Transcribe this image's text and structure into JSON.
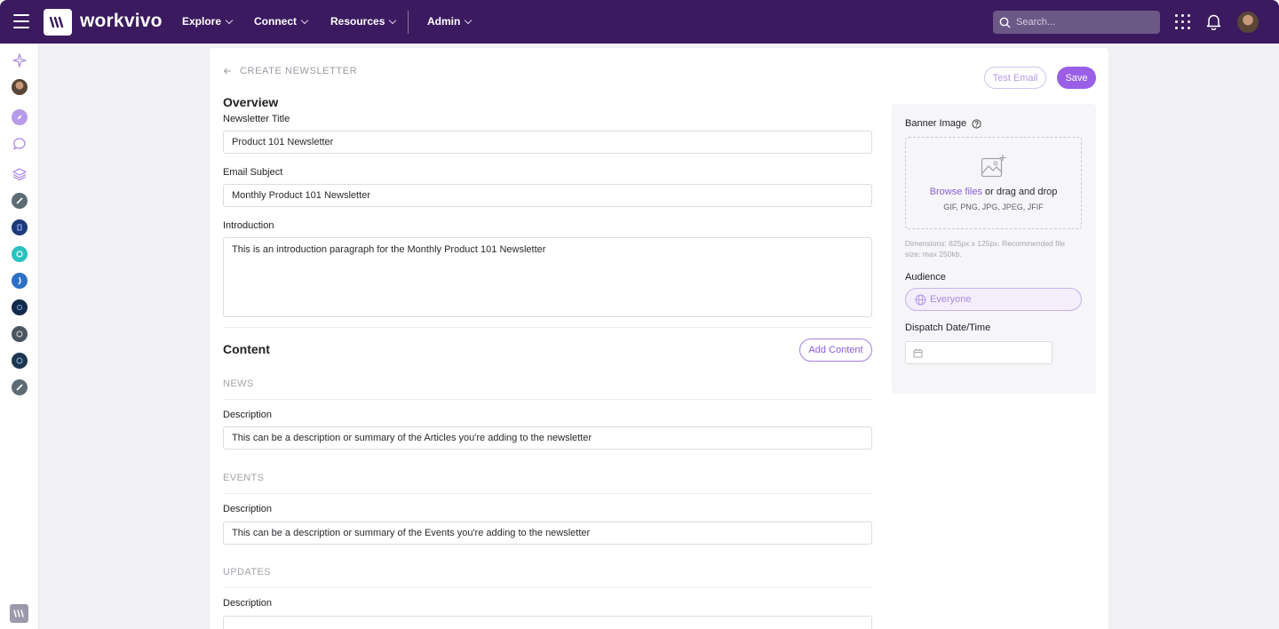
{
  "app": {
    "brand": "workvivo",
    "accent": "#9a5fe6",
    "topbar_color": "#3b1a5f"
  },
  "nav": {
    "items": [
      {
        "label": "Explore"
      },
      {
        "label": "Connect"
      },
      {
        "label": "Resources"
      },
      {
        "label": "Admin"
      }
    ],
    "search_placeholder": "Search..."
  },
  "page": {
    "back_label": "CREATE NEWSLETTER",
    "test_email_label": "Test Email",
    "save_label": "Save"
  },
  "overview": {
    "heading": "Overview",
    "title_label": "Newsletter Title",
    "title_value": "Product 101 Newsletter",
    "subject_label": "Email Subject",
    "subject_value": "Monthly Product 101 Newsletter",
    "intro_label": "Introduction",
    "intro_value": "This is an introduction paragraph for the Monthly Product 101 Newsletter"
  },
  "content": {
    "heading": "Content",
    "add_label": "Add Content",
    "sections": [
      {
        "name": "NEWS",
        "desc_label": "Description",
        "desc_value": "This can be a description or summary of the Articles you're adding to the newsletter"
      },
      {
        "name": "EVENTS",
        "desc_label": "Description",
        "desc_value": "This can be a description or summary of the Events you're adding to the newsletter"
      },
      {
        "name": "UPDATES",
        "desc_label": "Description",
        "desc_value": ""
      }
    ]
  },
  "sidebar_panel": {
    "banner_label": "Banner Image",
    "browse_label": "Browse files",
    "drag_label": " or drag and drop",
    "formats": "GIF, PNG, JPG, JPEG, JFIF",
    "hint": "Dimensions: 825px x 125px. Recommended file size: max 250kb.",
    "audience_label": "Audience",
    "audience_value": "Everyone",
    "dispatch_label": "Dispatch Date/Time"
  },
  "icons": {
    "rail": [
      "sparkle-icon",
      "avatar",
      "compass-icon",
      "chat-icon",
      "layers-icon",
      "space-icon",
      "space-icon",
      "space-icon",
      "space-icon",
      "space-icon",
      "space-icon",
      "space-icon",
      "space-icon"
    ]
  }
}
